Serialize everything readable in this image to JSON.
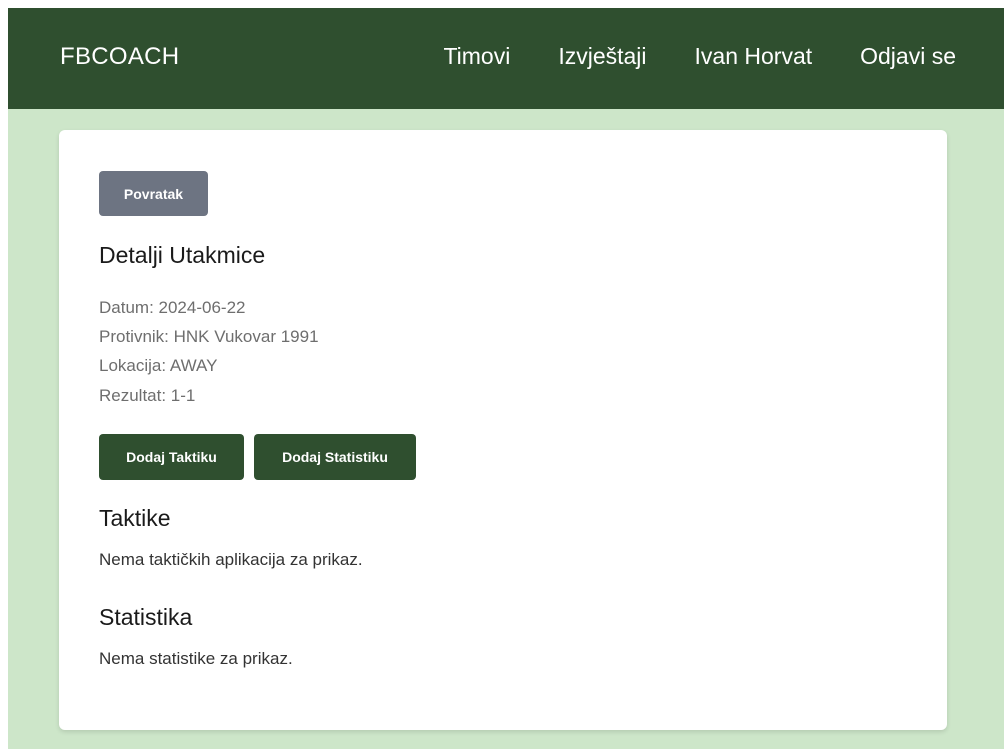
{
  "navbar": {
    "brand": "FBCOACH",
    "links": [
      "Timovi",
      "Izvještaji",
      "Ivan Horvat",
      "Odjavi se"
    ]
  },
  "card": {
    "back_label": "Povratak",
    "title": "Detalji Utakmice",
    "details": {
      "date": "Datum: 2024-06-22",
      "opponent": "Protivnik: HNK Vukovar 1991",
      "location": "Lokacija: AWAY",
      "result": "Rezultat: 1-1"
    },
    "add_tactic_label": "Dodaj Taktiku",
    "add_stat_label": "Dodaj Statistiku",
    "tactics_title": "Taktike",
    "tactics_empty": "Nema taktičkih aplikacija za prikaz.",
    "stats_title": "Statistika",
    "stats_empty": "Nema statistike za prikaz."
  },
  "colors": {
    "navbar": "#2f4f2f",
    "page_background": "#cde6c9",
    "back_button": "#6d7482",
    "primary_button": "#2f4f2f"
  }
}
